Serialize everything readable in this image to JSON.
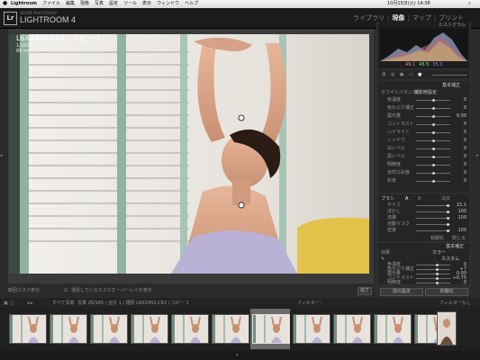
{
  "menubar": {
    "apple": "",
    "items": [
      "Lightroom",
      "ファイル",
      "編集",
      "現像",
      "写真",
      "設定",
      "ツール",
      "表示",
      "ウィンドウ",
      "ヘルプ"
    ],
    "status_time": "10月15日(火) 14:38"
  },
  "header": {
    "logo": "Lr",
    "subtitle": "ADOBE PHOTOSHOP",
    "title": "LIGHTROOM 4",
    "modules": [
      "ライブラリ",
      "現像",
      "マップ",
      "ブリント"
    ],
    "active_module": "現像"
  },
  "photo_info": {
    "filename": "L6X2450.CR2 - コピー 1",
    "exposure": "1/1600 秒 f/2.8 , ISO 500",
    "lens": "88 mm (EF70-200mm f/2.8L IS II USM)"
  },
  "histogram": {
    "title": "ヒストグラム",
    "readout": [
      "49.1",
      "45.5",
      "35.3"
    ]
  },
  "basic_panel": {
    "header": "基本補正",
    "wb_label": "ホワイトバランス",
    "wb_value": "撮影時設定",
    "rows": [
      {
        "label": "色温度",
        "value": "0"
      },
      {
        "label": "色かぶり補正",
        "value": "0"
      },
      {
        "label": "露光量",
        "value": "0.00"
      },
      {
        "label": "コントラスト",
        "value": "0"
      },
      {
        "label": "ハイライト",
        "value": "0"
      },
      {
        "label": "シャドウ",
        "value": "0"
      },
      {
        "label": "白レベル",
        "value": "0"
      },
      {
        "label": "黒レベル",
        "value": "0"
      },
      {
        "label": "明瞭度",
        "value": "0"
      },
      {
        "label": "自然な彩度",
        "value": "0"
      },
      {
        "label": "彩度",
        "value": "0"
      }
    ]
  },
  "brush_panel": {
    "header": "ブラシ",
    "tabs": [
      "A",
      "B",
      "消去"
    ],
    "rows": [
      {
        "label": "サイズ",
        "value": "15.1"
      },
      {
        "label": "ぼかし",
        "value": "100"
      },
      {
        "label": "流量",
        "value": "100"
      },
      {
        "label": "自動マスク",
        "value": ""
      },
      {
        "label": "密度",
        "value": "100"
      }
    ],
    "buttons": [
      "初期化",
      "閉じる"
    ]
  },
  "tone_panel": {
    "header": "基本補正",
    "mode_label": "効果",
    "mode_value": "カラー",
    "profile": "カスタム",
    "rows": [
      {
        "label": "色温度",
        "value": "0"
      },
      {
        "label": "色かぶり補正",
        "value": "+7"
      },
      {
        "label": "露光量",
        "value": "0.00"
      },
      {
        "label": "コントラスト",
        "value": "+0.75"
      },
      {
        "label": "明瞭度",
        "value": "0"
      }
    ]
  },
  "panel_buttons": [
    "前の設定",
    "初期化"
  ],
  "toolbar_bottom": {
    "mask_label": "範囲マスク表示",
    "overlay_label": "選択しているマスクオーバーレイを表示",
    "done_button": "完了"
  },
  "filmstrip_bar": {
    "label": "すべて写真",
    "path": "写真 26/165 / 合計 1 / 選択 L6X2450.CR2 / コピー 1",
    "filter_label": "フィルター：",
    "filter_value": "フィルターなし"
  },
  "filmstrip": {
    "count": 11,
    "selected_index": 6
  },
  "colors": {
    "accent": "#e6e6e6",
    "panel_bg": "#2f2f2f"
  }
}
